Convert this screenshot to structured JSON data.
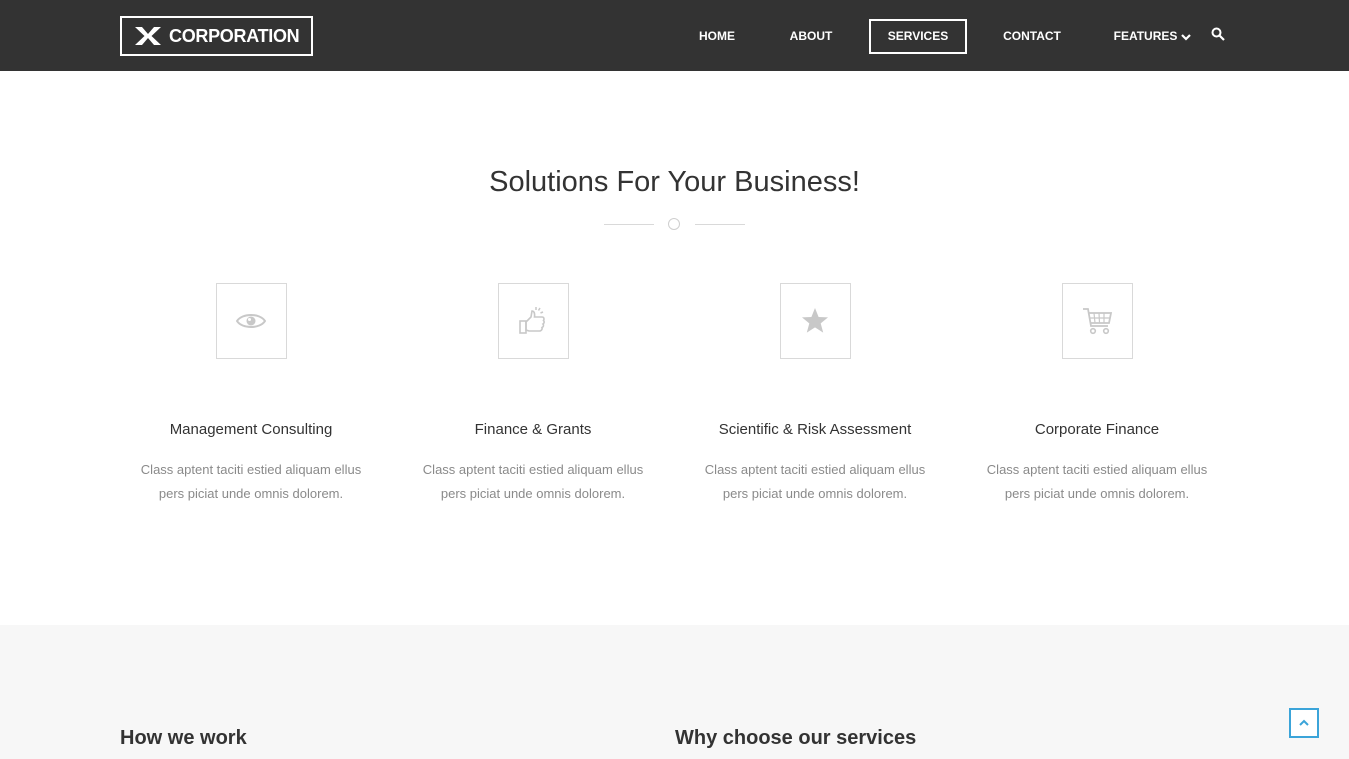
{
  "header": {
    "logo_text": "CORPORATION",
    "nav": {
      "home": "HOME",
      "about": "ABOUT",
      "services": "SERVICES",
      "contact": "CONTACT",
      "features": "FEATURES"
    },
    "search_icon": "search-icon",
    "dropdown_icon": "chevron-down-icon",
    "active_item": "SERVICES"
  },
  "solutions": {
    "title": "Solutions For Your Business!",
    "items": [
      {
        "icon": "eye-icon",
        "title": "Management Consulting",
        "desc": "Class aptent taciti estied aliquam ellus pers piciat unde omnis dolorem."
      },
      {
        "icon": "thumbs-up-icon",
        "title": "Finance & Grants",
        "desc": "Class aptent taciti estied aliquam ellus pers piciat unde omnis dolorem."
      },
      {
        "icon": "star-icon",
        "title": "Scientific & Risk Assessment",
        "desc": "Class aptent taciti estied aliquam ellus pers piciat unde omnis dolorem."
      },
      {
        "icon": "shopping-cart-icon",
        "title": "Corporate Finance",
        "desc": "Class aptent taciti estied aliquam ellus pers piciat unde omnis dolorem."
      }
    ]
  },
  "bottom": {
    "how_title": "How we work",
    "why_title": "Why choose our services"
  },
  "colors": {
    "navbar": "#333333",
    "accent": "#3ba4d9",
    "icon_gray": "#cccccc",
    "section_gray": "#f7f7f7"
  }
}
